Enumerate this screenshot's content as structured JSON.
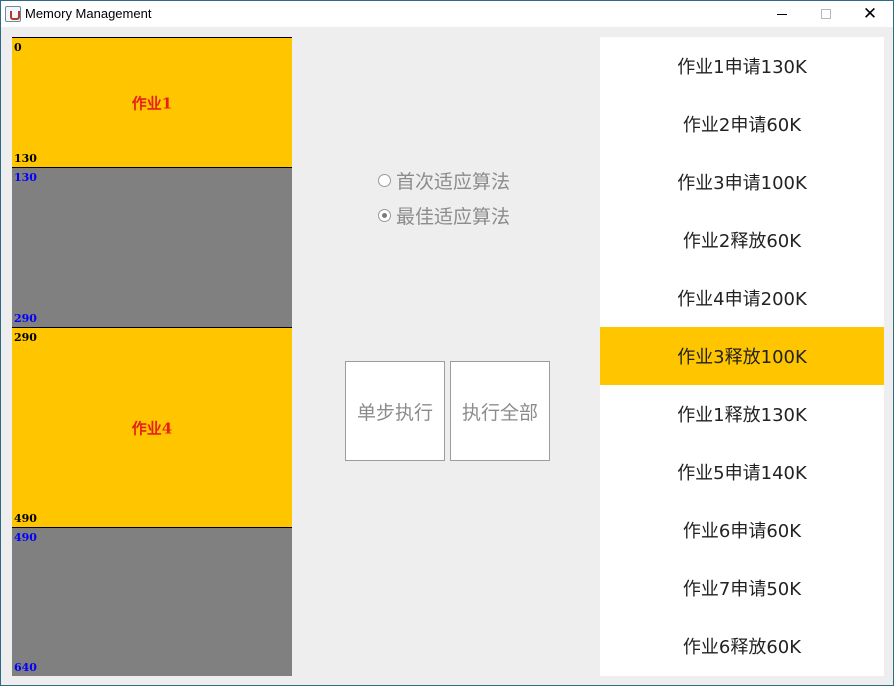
{
  "window": {
    "title": "Memory Management"
  },
  "memory": {
    "blocks": [
      {
        "start": "0",
        "end": "130",
        "label": "作业1",
        "state": "used"
      },
      {
        "start": "130",
        "end": "290",
        "label": "",
        "state": "free"
      },
      {
        "start": "290",
        "end": "490",
        "label": "作业4",
        "state": "used"
      },
      {
        "start": "490",
        "end": "640",
        "label": "",
        "state": "free"
      }
    ],
    "colors": {
      "used": "#ffc600",
      "free": "#808080",
      "job_text": "#e8201a",
      "free_addr_text": "#0000ff"
    }
  },
  "algorithms": {
    "options": [
      {
        "label": "首次适应算法",
        "selected": false
      },
      {
        "label": "最佳适应算法",
        "selected": true
      }
    ]
  },
  "buttons": {
    "step": "单步执行",
    "all": "执行全部"
  },
  "operations": {
    "items": [
      "作业1申请130K",
      "作业2申请60K",
      "作业3申请100K",
      "作业2释放60K",
      "作业4申请200K",
      "作业3释放100K",
      "作业1释放130K",
      "作业5申请140K",
      "作业6申请60K",
      "作业7申请50K",
      "作业6释放60K"
    ],
    "current_index": 5,
    "highlight_color": "#ffc600"
  }
}
